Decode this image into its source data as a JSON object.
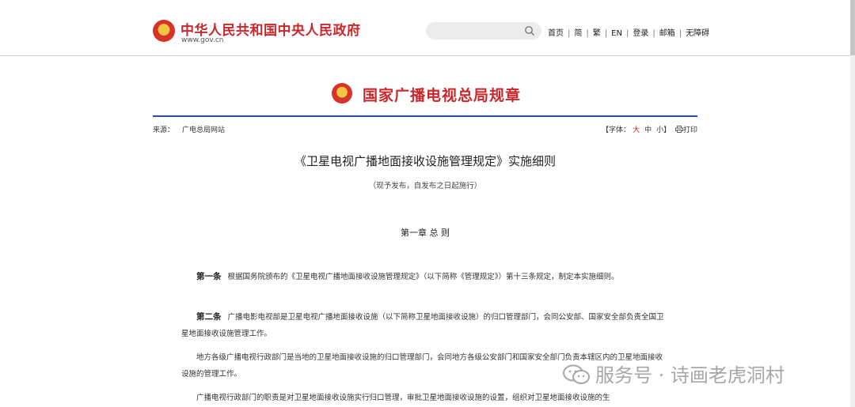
{
  "header": {
    "site_title": "中华人民共和国中央人民政府",
    "site_url": "www.gov.cn",
    "search_placeholder": "",
    "links": [
      "首页",
      "简",
      "繁",
      "EN",
      "登录",
      "邮箱",
      "无障碍"
    ]
  },
  "banner": {
    "title": "国家广播电视总局规章"
  },
  "meta": {
    "source_label": "来源：",
    "source_value": "广电总局网站",
    "font_label": "【字体：",
    "font_big": "大",
    "font_mid": "中",
    "font_small": "小】",
    "print_label": "打印"
  },
  "document": {
    "title": "《卫星电视广播地面接收设施管理规定》实施细则",
    "subtitle": "（现予发布，自发布之日起施行）",
    "chapter": "第一章 总 则",
    "paragraphs": [
      {
        "lead": "第一条",
        "text": "根据国务院颁布的《卫星电视广播地面接收设施管理规定》（以下简称《管理规定》）第十三条规定，制定本实施细则。"
      },
      {
        "lead": "第二条",
        "text": "广播电影电视部是卫星电视广播地面接收设施（以下简称卫星地面接收设施）的归口管理部门，会同公安部、国家安全部负责全国卫星地面接收设施管理工作。"
      },
      {
        "lead": "",
        "text": "地方各级广播电视行政部门是当地的卫星地面接收设施的归口管理部门，会同地方各级公安部门和国家安全部门负责本辖区内的卫星地面接收设施的管理工作。"
      },
      {
        "lead": "",
        "text": "广播电视行政部门的职责是对卫星地面接收设施实行归口管理，审批卫星地面接收设施的设置，组织对卫星地面接收设施的生"
      }
    ]
  },
  "watermark": {
    "text": "服务号 · 诗画老虎洞村"
  },
  "colors": {
    "brand_red": "#c8282b",
    "rule_blue": "#1f4f9e"
  }
}
